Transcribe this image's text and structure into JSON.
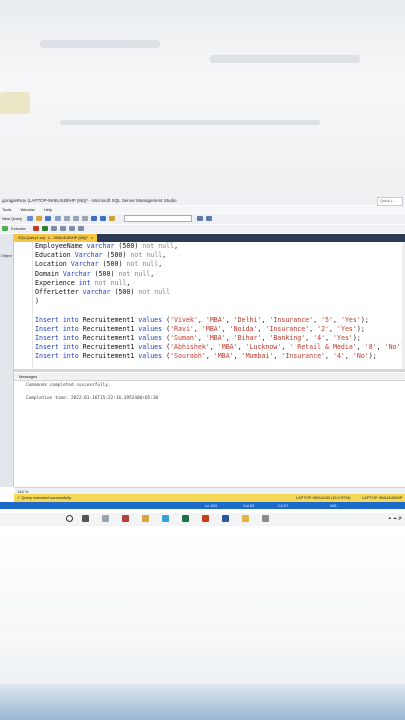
{
  "window": {
    "title": "gorajpetNov (LAPTOP-9K6U4UB\\HP (65))* - Microsoft SQL Server Management Studio",
    "quick_launch": "Quick L..."
  },
  "menubar": {
    "items": [
      "Tools",
      "Window",
      "Help"
    ]
  },
  "toolbar": {
    "new_query": "New Query",
    "execute": "Execute"
  },
  "sidebar": {
    "label": "Object"
  },
  "tab": {
    "label": "SQLQuery1.sql - L...9K6U4UB\\HP (65))*"
  },
  "editor": {
    "lines": [
      {
        "t": "EmployeeName varchar (500) not null,"
      },
      {
        "t": "Education Varchar (500) not null,"
      },
      {
        "t": "Location Varchar (500) not null,"
      },
      {
        "t": "Domain Varchar (500) not null,"
      },
      {
        "t": "Experience int not null,"
      },
      {
        "t": "OfferLetter varchar (500) not null"
      },
      {
        "t": ")"
      },
      {
        "t": ""
      },
      {
        "t": "Insert into Recruitement1 values ('Vivek', 'MBA', 'Delhi', 'Insurance', '5', 'Yes');"
      },
      {
        "t": "Insert into Recruitement1 values ('Ravi', 'MBA', 'Noida', 'Insurance', '2', 'Yes');"
      },
      {
        "t": "Insert into Recruitement1 values ('Suman', 'MBA', 'Bihar', 'Banking', '4', 'Yes');"
      },
      {
        "t": "Insert into Recruitement1 values ('Abhishek', 'MBA', 'Lucknow', ' Retail & Media', '8', 'No')"
      },
      {
        "t": "Insert into Recruitement1 values ('Sourabh', 'MBA', 'Mumbai', 'Insurance', '4', 'No');"
      }
    ]
  },
  "messages": {
    "tab_label": "Messages",
    "line1": "Commands completed successfully.",
    "line2": "Completion time: 2022-01-16T15:22:16.3952406+05:30"
  },
  "zoom": {
    "value": "146 %"
  },
  "query_status": {
    "message": "Query executed successfully.",
    "server": "LAPTOP-9K6U4UB (15.0 RTM)",
    "login": "LAPTOP-9K6U4UB\\HP"
  },
  "statusbar": {
    "ln": "Ln 463",
    "col": "Col 63",
    "ch": "Ch 57",
    "ins": "INS"
  },
  "colors": {
    "accent": "#f5c744",
    "status_blue": "#1c6bc9",
    "keyword": "#1f3fbf",
    "string": "#c0392b"
  }
}
